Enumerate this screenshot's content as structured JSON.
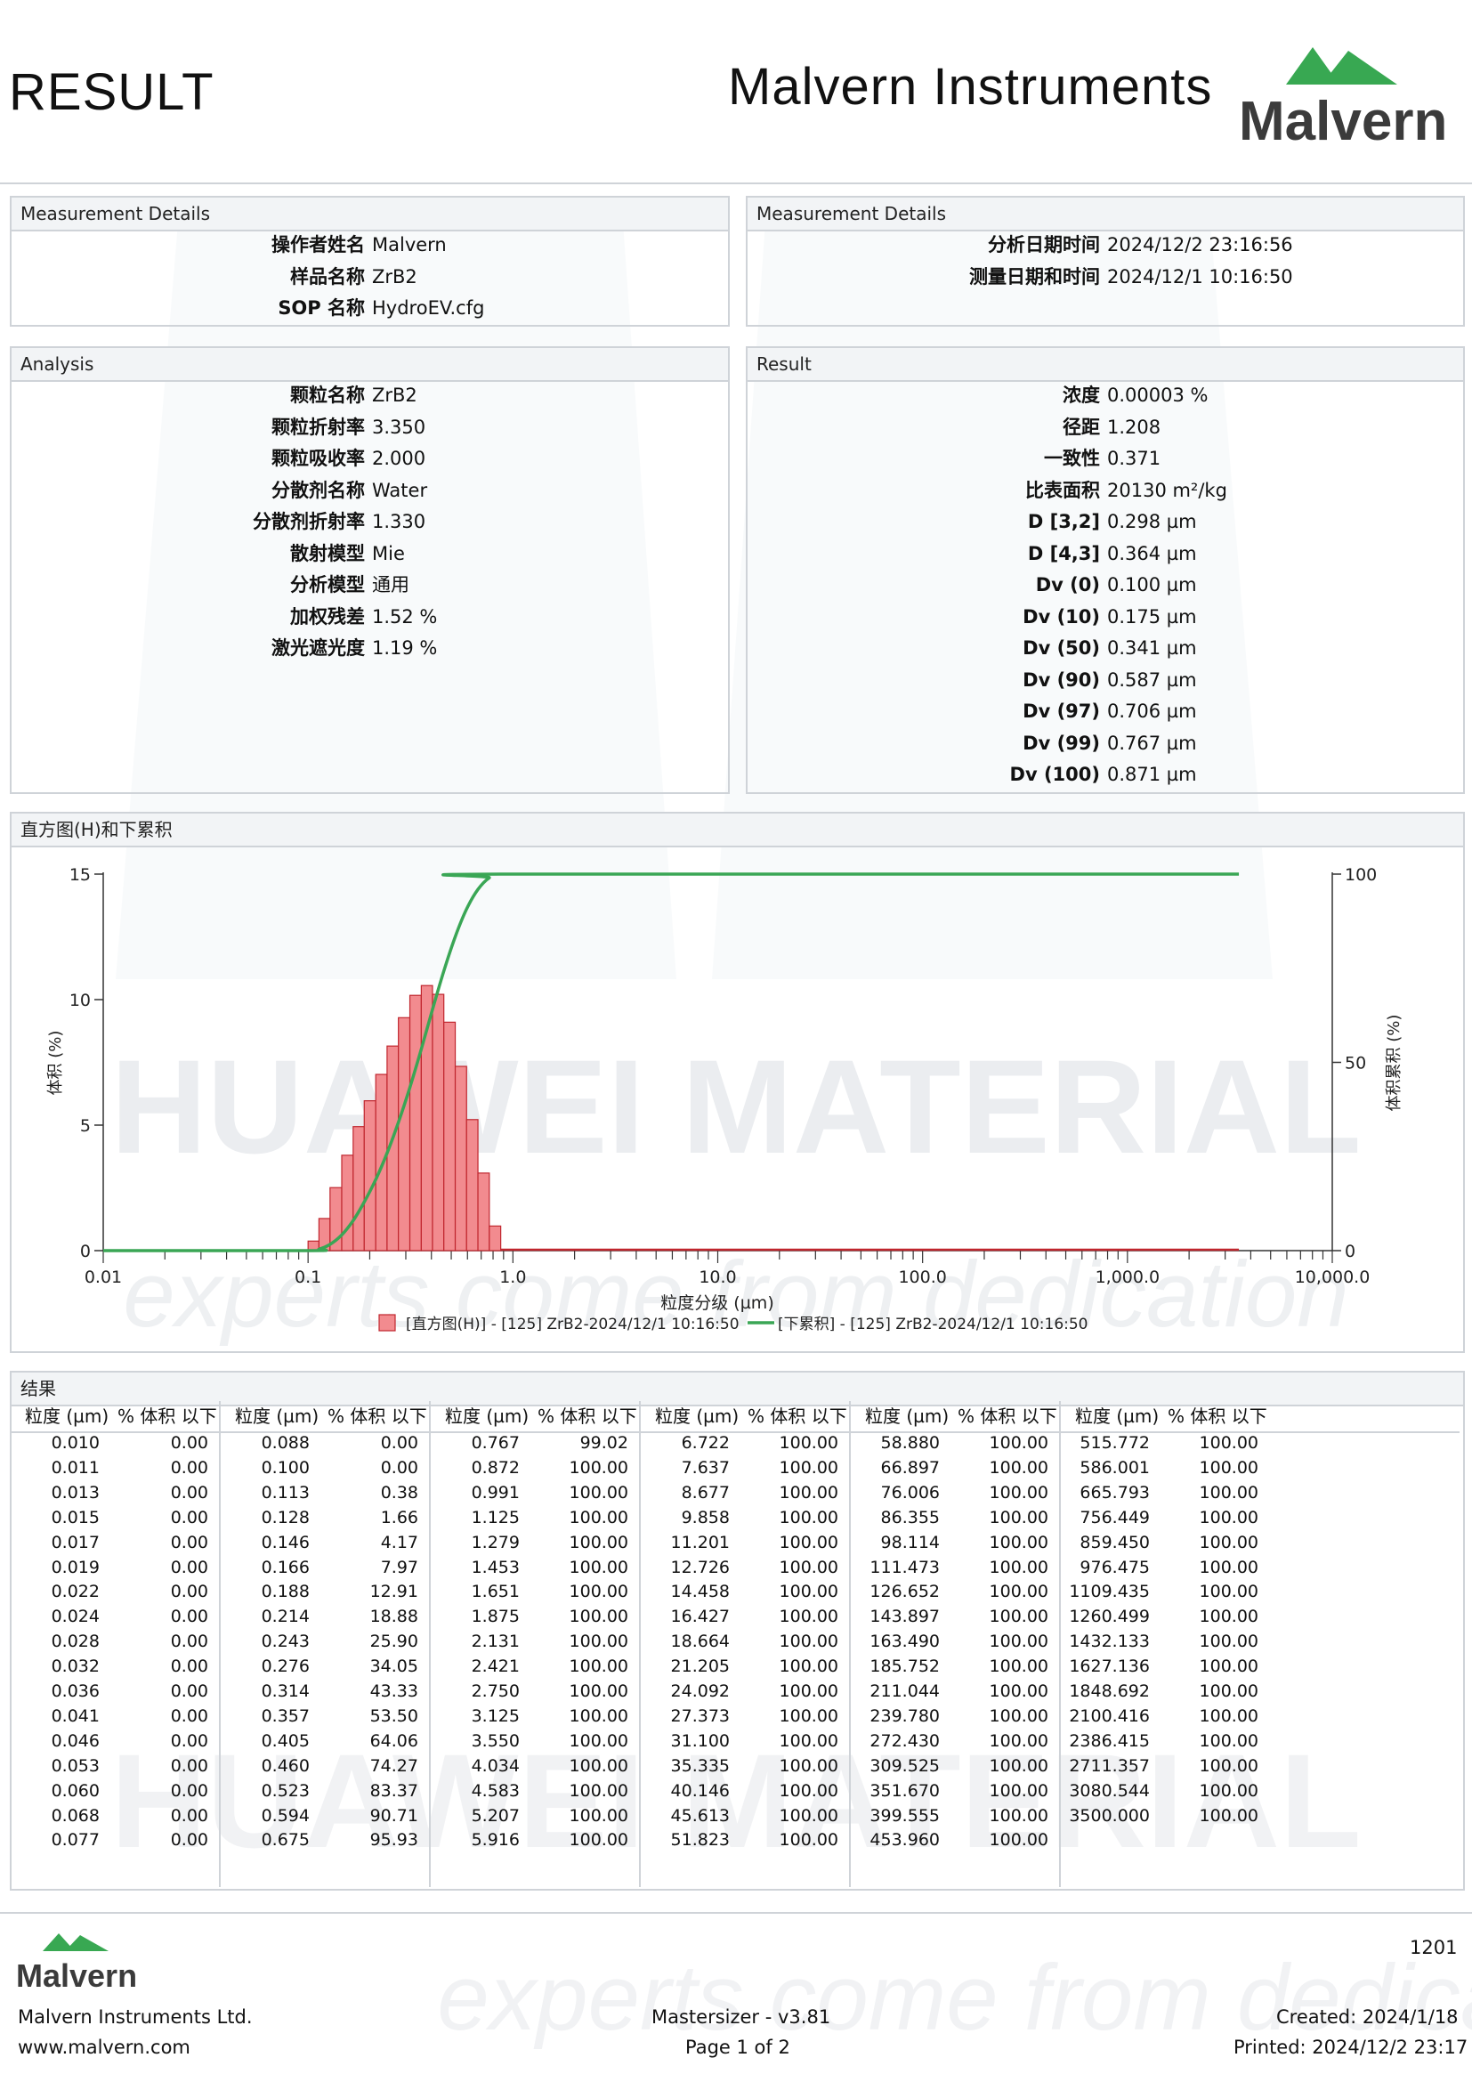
{
  "header": {
    "page_title": "RESULT",
    "company_name": "Malvern Instruments",
    "logo_text": "Malvern"
  },
  "watermark": {
    "line1": "HUAWEI MATERIAL",
    "line2": "experts come from dedication"
  },
  "measurement_left": {
    "title": "Measurement Details",
    "rows": [
      {
        "label": "操作者姓名",
        "value": "Malvern"
      },
      {
        "label": "样品名称",
        "value": "ZrB2"
      },
      {
        "label": "SOP 名称",
        "value": "HydroEV.cfg"
      }
    ]
  },
  "measurement_right": {
    "title": "Measurement Details",
    "rows": [
      {
        "label": "分析日期时间",
        "value": "2024/12/2 23:16:56"
      },
      {
        "label": "测量日期和时间",
        "value": "2024/12/1 10:16:50"
      }
    ]
  },
  "analysis": {
    "title": "Analysis",
    "rows": [
      {
        "label": "颗粒名称",
        "value": "ZrB2"
      },
      {
        "label": "颗粒折射率",
        "value": "3.350"
      },
      {
        "label": "颗粒吸收率",
        "value": "2.000"
      },
      {
        "label": "分散剂名称",
        "value": "Water"
      },
      {
        "label": "分散剂折射率",
        "value": "1.330"
      },
      {
        "label": "散射模型",
        "value": "Mie"
      },
      {
        "label": "分析模型",
        "value": "通用"
      },
      {
        "label": "加权残差",
        "value": "1.52 %"
      },
      {
        "label": "激光遮光度",
        "value": "1.19 %"
      }
    ]
  },
  "result": {
    "title": "Result",
    "rows": [
      {
        "label": "浓度",
        "value": "0.00003 %"
      },
      {
        "label": "径距",
        "value": "1.208"
      },
      {
        "label": "一致性",
        "value": "0.371"
      },
      {
        "label": "比表面积",
        "value": "20130 m²/kg"
      },
      {
        "label": "D [3,2]",
        "value": "0.298 µm"
      },
      {
        "label": "D [4,3]",
        "value": "0.364 µm"
      },
      {
        "label": "Dv (0)",
        "value": "0.100 µm"
      },
      {
        "label": "Dv (10)",
        "value": "0.175 µm"
      },
      {
        "label": "Dv (50)",
        "value": "0.341 µm"
      },
      {
        "label": "Dv (90)",
        "value": "0.587 µm"
      },
      {
        "label": "Dv (97)",
        "value": "0.706 µm"
      },
      {
        "label": "Dv (99)",
        "value": "0.767 µm"
      },
      {
        "label": "Dv (100)",
        "value": "0.871 µm"
      }
    ]
  },
  "chart_panel": {
    "title": "直方图(H)和下累积"
  },
  "chart_data": {
    "type": "bar",
    "title": "",
    "xlabel": "粒度分级 (µm)",
    "ylabel": "体积 (%)",
    "y2label": "体积累积 (%)",
    "x_scale": "log",
    "xlim": [
      0.01,
      10000
    ],
    "ylim": [
      0,
      15
    ],
    "y2lim": [
      0,
      100
    ],
    "x_ticks": [
      0.01,
      0.1,
      1.0,
      10.0,
      100.0,
      1000.0,
      10000.0
    ],
    "x_tick_labels": [
      "0.01",
      "0.1",
      "1.0",
      "10.0",
      "100.0",
      "1,000.0",
      "10,000.0"
    ],
    "y_ticks": [
      "0",
      "5",
      "10",
      "15"
    ],
    "y2_ticks": [
      "0",
      "50",
      "100"
    ],
    "legend_position": "bottom-center",
    "colors": {
      "histogram_fill": "#f28b8f",
      "histogram_edge": "#c0262e",
      "cumulative_line": "#3aa655"
    },
    "series": [
      {
        "name": "[直方图(H)] - [125] ZrB2-2024/12/1 10:16:50",
        "kind": "histogram",
        "bin_edges": [
          0.1,
          0.113,
          0.128,
          0.146,
          0.166,
          0.188,
          0.214,
          0.243,
          0.276,
          0.314,
          0.357,
          0.405,
          0.46,
          0.523,
          0.594,
          0.675,
          0.767,
          0.872
        ],
        "values": [
          0.38,
          1.28,
          2.51,
          3.8,
          4.94,
          5.97,
          7.02,
          8.15,
          9.28,
          10.17,
          10.56,
          10.21,
          9.1,
          7.34,
          5.22,
          3.09,
          0.98
        ]
      },
      {
        "name": "[下累积] - [125] ZrB2-2024/12/1 10:16:50",
        "kind": "cumulative",
        "x": [
          0.01,
          0.1,
          0.113,
          0.128,
          0.146,
          0.166,
          0.188,
          0.214,
          0.243,
          0.276,
          0.314,
          0.357,
          0.405,
          0.46,
          0.523,
          0.594,
          0.675,
          0.767,
          0.872,
          3500.0
        ],
        "values": [
          0.0,
          0.0,
          0.38,
          1.66,
          4.17,
          7.97,
          12.91,
          18.88,
          25.9,
          34.05,
          43.33,
          53.5,
          64.06,
          74.27,
          83.37,
          90.71,
          95.93,
          99.02,
          100.0,
          100.0
        ]
      }
    ]
  },
  "table": {
    "title": "结果",
    "col_size": "粒度 (µm)",
    "col_vol": "% 体积 以下",
    "groups": [
      {
        "sizes": [
          "0.010",
          "0.011",
          "0.013",
          "0.015",
          "0.017",
          "0.019",
          "0.022",
          "0.024",
          "0.028",
          "0.032",
          "0.036",
          "0.041",
          "0.046",
          "0.053",
          "0.060",
          "0.068",
          "0.077"
        ],
        "vols": [
          "0.00",
          "0.00",
          "0.00",
          "0.00",
          "0.00",
          "0.00",
          "0.00",
          "0.00",
          "0.00",
          "0.00",
          "0.00",
          "0.00",
          "0.00",
          "0.00",
          "0.00",
          "0.00",
          "0.00"
        ]
      },
      {
        "sizes": [
          "0.088",
          "0.100",
          "0.113",
          "0.128",
          "0.146",
          "0.166",
          "0.188",
          "0.214",
          "0.243",
          "0.276",
          "0.314",
          "0.357",
          "0.405",
          "0.460",
          "0.523",
          "0.594",
          "0.675"
        ],
        "vols": [
          "0.00",
          "0.00",
          "0.38",
          "1.66",
          "4.17",
          "7.97",
          "12.91",
          "18.88",
          "25.90",
          "34.05",
          "43.33",
          "53.50",
          "64.06",
          "74.27",
          "83.37",
          "90.71",
          "95.93"
        ]
      },
      {
        "sizes": [
          "0.767",
          "0.872",
          "0.991",
          "1.125",
          "1.279",
          "1.453",
          "1.651",
          "1.875",
          "2.131",
          "2.421",
          "2.750",
          "3.125",
          "3.550",
          "4.034",
          "4.583",
          "5.207",
          "5.916"
        ],
        "vols": [
          "99.02",
          "100.00",
          "100.00",
          "100.00",
          "100.00",
          "100.00",
          "100.00",
          "100.00",
          "100.00",
          "100.00",
          "100.00",
          "100.00",
          "100.00",
          "100.00",
          "100.00",
          "100.00",
          "100.00"
        ]
      },
      {
        "sizes": [
          "6.722",
          "7.637",
          "8.677",
          "9.858",
          "11.201",
          "12.726",
          "14.458",
          "16.427",
          "18.664",
          "21.205",
          "24.092",
          "27.373",
          "31.100",
          "35.335",
          "40.146",
          "45.613",
          "51.823"
        ],
        "vols": [
          "100.00",
          "100.00",
          "100.00",
          "100.00",
          "100.00",
          "100.00",
          "100.00",
          "100.00",
          "100.00",
          "100.00",
          "100.00",
          "100.00",
          "100.00",
          "100.00",
          "100.00",
          "100.00",
          "100.00"
        ]
      },
      {
        "sizes": [
          "58.880",
          "66.897",
          "76.006",
          "86.355",
          "98.114",
          "111.473",
          "126.652",
          "143.897",
          "163.490",
          "185.752",
          "211.044",
          "239.780",
          "272.430",
          "309.525",
          "351.670",
          "399.555",
          "453.960"
        ],
        "vols": [
          "100.00",
          "100.00",
          "100.00",
          "100.00",
          "100.00",
          "100.00",
          "100.00",
          "100.00",
          "100.00",
          "100.00",
          "100.00",
          "100.00",
          "100.00",
          "100.00",
          "100.00",
          "100.00",
          "100.00"
        ]
      },
      {
        "sizes": [
          "515.772",
          "586.001",
          "665.793",
          "756.449",
          "859.450",
          "976.475",
          "1109.435",
          "1260.499",
          "1432.133",
          "1627.136",
          "1848.692",
          "2100.416",
          "2386.415",
          "2711.357",
          "3080.544",
          "3500.000"
        ],
        "vols": [
          "100.00",
          "100.00",
          "100.00",
          "100.00",
          "100.00",
          "100.00",
          "100.00",
          "100.00",
          "100.00",
          "100.00",
          "100.00",
          "100.00",
          "100.00",
          "100.00",
          "100.00",
          "100.00"
        ]
      }
    ]
  },
  "footer": {
    "page_id": "1201",
    "logo_text": "Malvern",
    "company": "Malvern Instruments Ltd.",
    "website": "www.malvern.com",
    "software": "Mastersizer - v3.81",
    "page": "Page 1 of 2",
    "created": "Created:  2024/1/18",
    "printed": "Printed: 2024/12/2 23:17"
  }
}
